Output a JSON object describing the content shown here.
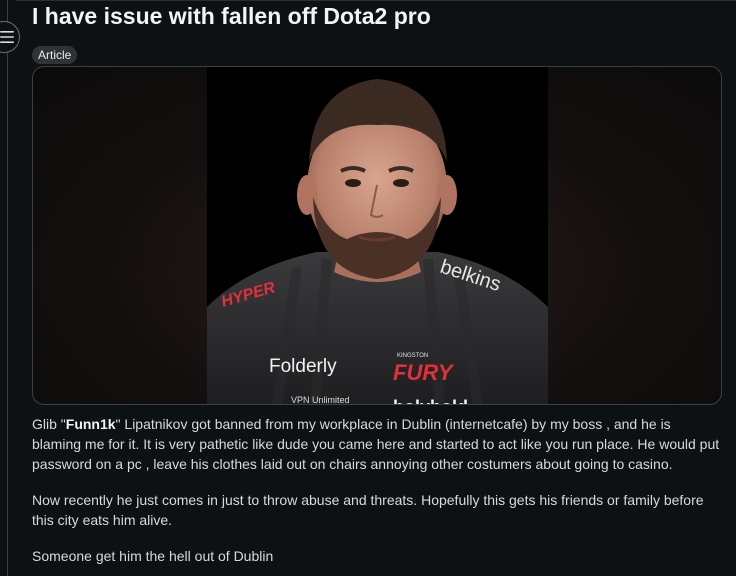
{
  "post": {
    "title": "I have issue with fallen off Dota2 pro",
    "flair": "Article",
    "image_alt": "Photo of a bearded man in a black esports jersey",
    "jersey": {
      "brand_left": "HYPER",
      "brand_right": "belkins",
      "sponsor_1": "Folderly",
      "sponsor_2": "FURY",
      "sponsor_2_small": "KINGSTON",
      "sponsor_3": "VPN Unlimited",
      "sponsor_4": "bolybold"
    },
    "body": {
      "p1_before": "Glib \"",
      "p1_name": "Funn1k",
      "p1_after": "\" Lipatnikov got banned from my workplace in Dublin (internetcafe) by my boss , and he is blaming me for it. It is very pathetic like dude you came here and started to act like you run place. He would put password on a pc , leave his clothes laid out on chairs annoying other costumers about going to casino.",
      "p2": "Now recently he just comes in just to throw abuse and threats. Hopefully this gets his friends or family before this city eats him alive.",
      "p3": "Someone get him the hell out of Dublin"
    }
  },
  "ui": {
    "menu_icon": "menu-icon",
    "colors": {
      "background": "#0e1113",
      "text": "#d7dadc",
      "flair_bg": "#2f3337"
    }
  }
}
